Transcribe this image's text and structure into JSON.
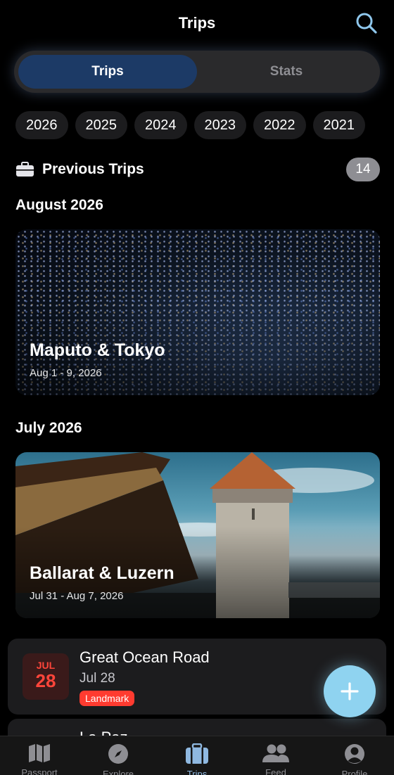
{
  "header": {
    "title": "Trips"
  },
  "segments": {
    "left": "Trips",
    "right": "Stats",
    "selected": "Trips"
  },
  "years": [
    "2026",
    "2025",
    "2024",
    "2023",
    "2022",
    "2021"
  ],
  "section": {
    "title": "Previous Trips",
    "count": "14"
  },
  "groups": [
    {
      "month": "August 2026",
      "trip": {
        "title": "Maputo & Tokyo",
        "dates": "Aug 1 - 9, 2026"
      }
    },
    {
      "month": "July 2026",
      "trip": {
        "title": "Ballarat & Luzern",
        "dates": "Jul 31 - Aug 7, 2026"
      }
    }
  ],
  "list_items": [
    {
      "cal_month": "JUL",
      "cal_day": "28",
      "title": "Great Ocean Road",
      "date": "Jul 28",
      "tag": "Landmark"
    },
    {
      "title": "La Paz"
    }
  ],
  "tabs": [
    {
      "label": "Passport",
      "icon": "map-icon"
    },
    {
      "label": "Explore",
      "icon": "compass-icon"
    },
    {
      "label": "Trips",
      "icon": "suitcase-icon",
      "active": true
    },
    {
      "label": "Feed",
      "icon": "people-icon"
    },
    {
      "label": "Profile",
      "icon": "person-icon"
    }
  ],
  "colors": {
    "accent": "#1c3a66",
    "fab": "#8fd3f0",
    "tag": "#ff3b30",
    "active_tab": "#8fb8e0"
  }
}
